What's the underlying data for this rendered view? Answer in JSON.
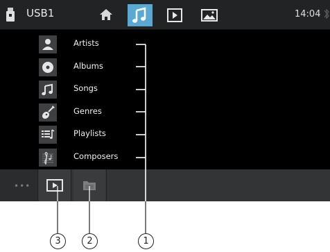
{
  "header": {
    "source_label": "USB1",
    "time": "14:04",
    "tabs": [
      "home-icon",
      "music-icon",
      "video-icon",
      "photo-icon"
    ],
    "active_tab": "music",
    "accent_color": "#5aa9d3"
  },
  "categories": [
    {
      "label": "Artists",
      "icon": "artist-icon"
    },
    {
      "label": "Albums",
      "icon": "album-icon"
    },
    {
      "label": "Songs",
      "icon": "song-note-icon"
    },
    {
      "label": "Genres",
      "icon": "guitar-icon"
    },
    {
      "label": "Playlists",
      "icon": "playlist-icon"
    },
    {
      "label": "Composers",
      "icon": "composer-icon"
    }
  ],
  "toolbar": {
    "more_label": "•••",
    "buttons": [
      "play-icon",
      "folder-icon"
    ]
  },
  "callouts": [
    "1",
    "2",
    "3"
  ]
}
